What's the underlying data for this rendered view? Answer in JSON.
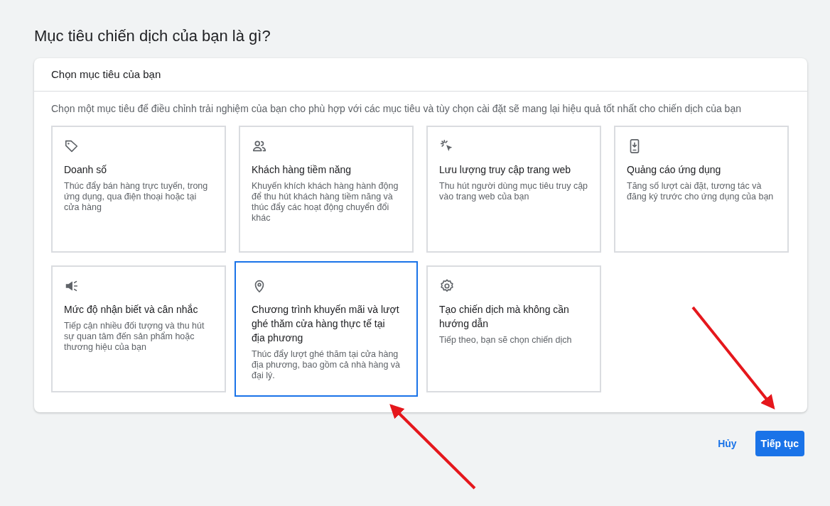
{
  "page_title": "Mục tiêu chiến dịch của bạn là gì?",
  "panel": {
    "title": "Chọn mục tiêu của bạn",
    "description": "Chọn một mục tiêu để điều chỉnh trải nghiệm của bạn cho phù hợp với các mục tiêu và tùy chọn cài đặt sẽ mang lại hiệu quả tốt nhất cho chiến dịch của bạn",
    "goals": [
      {
        "kind": "tag",
        "title": "Doanh số",
        "text": "Thúc đẩy bán hàng trực tuyến, trong ứng dụng, qua điện thoại hoặc tại cửa hàng",
        "selected": false
      },
      {
        "kind": "people",
        "title": "Khách hàng tiềm năng",
        "text": "Khuyến khích khách hàng hành động để thu hút khách hàng tiềm năng và thúc đẩy các hoạt động chuyển đổi khác",
        "selected": false
      },
      {
        "kind": "click",
        "title": "Lưu lượng truy cập trang web",
        "text": "Thu hút người dùng mục tiêu truy cập vào trang web của bạn",
        "selected": false
      },
      {
        "kind": "phone",
        "title": "Quảng cáo ứng dụng",
        "text": "Tăng số lượt cài đặt, tương tác và đăng ký trước cho ứng dụng của bạn",
        "selected": false
      },
      {
        "kind": "megaphone",
        "title": "Mức độ nhận biết và cân nhắc",
        "text": "Tiếp cận nhiều đối tượng và thu hút sự quan tâm đến sản phẩm hoặc thương hiệu của bạn",
        "selected": false
      },
      {
        "kind": "pin",
        "title": "Chương trình khuyến mãi và lượt ghé thăm cửa hàng thực tế tại địa phương",
        "text": "Thúc đẩy lượt ghé thăm tại cửa hàng địa phương, bao gồm cả nhà hàng và đại lý.",
        "selected": true
      },
      {
        "kind": "gear",
        "title": "Tạo chiến dịch mà không cần hướng dẫn",
        "text": "Tiếp theo, bạn sẽ chọn chiến dịch",
        "selected": false
      }
    ]
  },
  "buttons": {
    "cancel": "Hủy",
    "continue": "Tiếp tục"
  }
}
